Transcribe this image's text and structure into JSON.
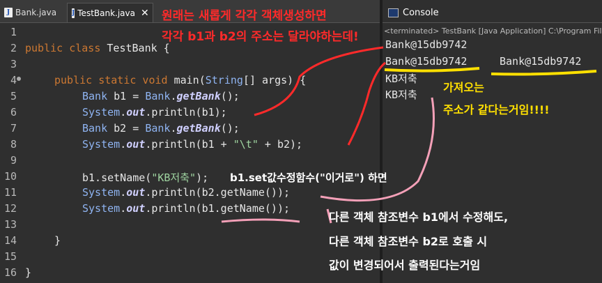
{
  "tabs": [
    {
      "label": "Bank.java",
      "icon": "java-file-icon",
      "active": false
    },
    {
      "label": "TestBank.java",
      "icon": "java-file-icon",
      "active": true
    }
  ],
  "line_numbers": [
    "1",
    "2",
    "3",
    "4",
    "5",
    "6",
    "7",
    "8",
    "9",
    "10",
    "11",
    "12",
    "13",
    "14",
    "15",
    "16"
  ],
  "code": {
    "l2": {
      "kw": "public class ",
      "name": "TestBank {"
    },
    "l4": {
      "kw": "public static void ",
      "a": "main(",
      "ty": "String",
      "b": "[] ",
      "c": "args) {"
    },
    "l5": {
      "ty": "Bank",
      "a": " b1 = ",
      "ty2": "Bank",
      "b": ".",
      "it": "getBank",
      "c": "();"
    },
    "l6": {
      "ty": "System",
      "a": ".",
      "it": "out",
      "b": ".println(b1);"
    },
    "l7": {
      "ty": "Bank",
      "a": " b2 = ",
      "ty2": "Bank",
      "b": ".",
      "it": "getBank",
      "c": "();"
    },
    "l8": {
      "ty": "System",
      "a": ".",
      "it": "out",
      "b": ".println(b1 + ",
      "str": "\"\\t\"",
      "c": " + b2);"
    },
    "l10": {
      "a": "b1.setName(",
      "str": "\"KB저축\"",
      "b": ");"
    },
    "l11": {
      "ty": "System",
      "a": ".",
      "it": "out",
      "b": ".println(b2.getName());"
    },
    "l12": {
      "ty": "System",
      "a": ".",
      "it": "out",
      "b": ".println(b1.getName());"
    },
    "l14": "}",
    "l16": "}"
  },
  "console": {
    "title": "Console",
    "terminated": "<terminated> TestBank [Java Application] C:\\Program Files",
    "lines": [
      "Bank@15db9742",
      "Bank@15db9742",
      "KB저축",
      "KB저축"
    ],
    "line2_tab": "Bank@15db9742"
  },
  "annotations": {
    "top1": "원래는 새롭게 각각 객체생성하면",
    "top2": "각각 b1과 b2의 주소는 달라야하는데!",
    "same1": "가져오는",
    "same2": "주소가 같다는거임!!!!",
    "setname": "b1.set값수정함수(\"이거로\") 하면",
    "bottom1": "다른 객체 참조변수 b1에서 수정해도,",
    "bottom2": "다른 객체 참조변수 b2로 호출 시",
    "bottom3": "값이 변경되어서 출력된다는거임"
  },
  "colors": {
    "red": "#ff2a2a",
    "yellow": "#ffe000",
    "pink": "#f4a0b8",
    "keyword": "#cc7832",
    "type": "#8fb4f2"
  }
}
